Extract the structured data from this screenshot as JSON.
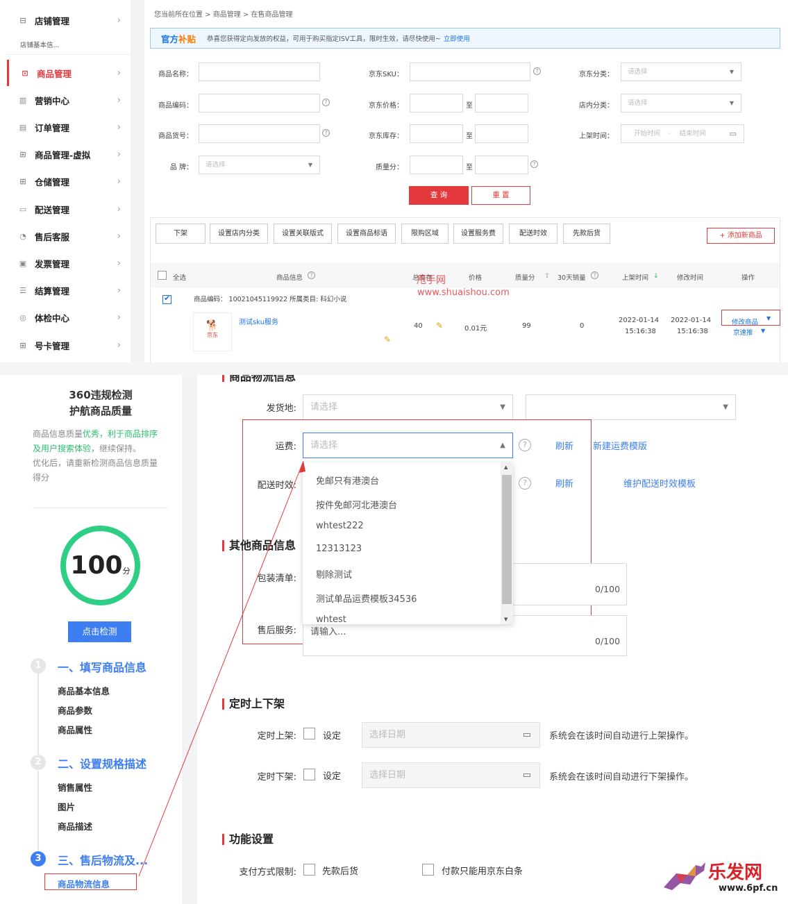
{
  "sidebar": {
    "store_mgmt": "店铺管理",
    "store_sub": "店铺基本信...",
    "items": [
      {
        "label": "商品管理",
        "icon": "bag-icon"
      },
      {
        "label": "营销中心",
        "icon": "chart-icon"
      },
      {
        "label": "订单管理",
        "icon": "doc-icon"
      },
      {
        "label": "商品管理-虚拟",
        "icon": "grid-icon"
      },
      {
        "label": "仓储管理",
        "icon": "grid-icon"
      },
      {
        "label": "配送管理",
        "icon": "truck-icon"
      },
      {
        "label": "售后客服",
        "icon": "headset-icon"
      },
      {
        "label": "发票管理",
        "icon": "invoice-icon"
      },
      {
        "label": "结算管理",
        "icon": "list-icon"
      },
      {
        "label": "体检中心",
        "icon": "shield-icon"
      },
      {
        "label": "号卡管理",
        "icon": "grid-icon"
      }
    ]
  },
  "breadcrumb": "您当前所在位置 > 商品管理 > 在售商品管理",
  "notice": {
    "tag_a": "官方",
    "tag_b": "补贴",
    "text": "恭喜您获得定向发放的权益，可用于购买指定ISV工具，限时生效，请尽快使用~",
    "link": "立即使用"
  },
  "filters": {
    "name": "商品名称：",
    "sku": "京东SKU：",
    "jd_cat": "京东分类：",
    "code": "商品编码：",
    "price": "京东价格：",
    "shop_cat": "店内分类：",
    "goods_no": "商品货号：",
    "stock": "京东库存：",
    "on_time": "上架时间：",
    "brand": "品 牌：",
    "quality": "质量分：",
    "placeholder_select": "请选择",
    "start": "开始时间",
    "sep": "-",
    "end": "结束时间",
    "to": "至"
  },
  "actions": {
    "query": "查 询",
    "reset": "重 置"
  },
  "toolbar": [
    "下架",
    "设置店内分类",
    "设置关联版式",
    "设置商品标语",
    "限购区域",
    "设置服务费",
    "配送时效",
    "先款后货"
  ],
  "add_product": "+ 添加新商品",
  "table": {
    "headers": {
      "select_all": "全选",
      "info": "商品信息",
      "stock": "总库存",
      "price": "价格",
      "quality": "质量分",
      "sales": "30天销量",
      "on_time": "上架时间",
      "mod_time": "修改时间",
      "op": "操作"
    },
    "row": {
      "meta": "商品编码：  10021045119922  所属类目: 科幻小说",
      "name": "测试sku服务",
      "img_label": "京东",
      "stock": "40",
      "price": "0.01元",
      "quality": "99",
      "sales": "0",
      "on_date": "2022-01-14",
      "on_clock": "15:16:38",
      "mod_date": "2022-01-14",
      "mod_clock": "15:16:38",
      "op1": "修改商品",
      "op2": "京速推"
    }
  },
  "watermark": {
    "text": "甩手网",
    "url": "www.shuaishou.com",
    "logo": "乐发网",
    "logo_url": "www.6pf.cn"
  },
  "quality_panel": {
    "title1": "360违规检测",
    "title2": "护航商品质量",
    "desc_a": "商品信息质量",
    "desc_b": "优秀，利于商品排序及用户搜索体验",
    "desc_c": "，继续保持。",
    "desc_d": "优化后，请重新检测商品信息质量得分",
    "score": "100",
    "unit": "分",
    "check_btn": "点击检测"
  },
  "steps": [
    {
      "num": "1",
      "title": "一、填写商品信息",
      "subs": [
        "商品基本信息",
        "商品参数",
        "商品属性"
      ]
    },
    {
      "num": "2",
      "title": "二、设置规格描述",
      "subs": [
        "销售属性",
        "图片",
        "商品描述"
      ]
    },
    {
      "num": "3",
      "title": "三、售后物流及...",
      "subs": [
        "商品物流信息"
      ]
    }
  ],
  "logistics": {
    "section_cut": "商品物流信息",
    "ship_from": "发货地:",
    "placeholder": "请选择",
    "freight": "运费:",
    "delivery": "配送时效:",
    "refresh": "刷新",
    "new_template": "新建运费模版",
    "maintain_template": "维护配送时效模板",
    "options": [
      "免邮只有港澳台",
      "按件免邮河北港澳台",
      "whtest222",
      "12313123",
      "剔除测试",
      "测试单品运费模板34536",
      "whtest"
    ]
  },
  "other": {
    "title": "其他商品信息",
    "packing": "包装清单:",
    "after_sale": "售后服务:",
    "placeholder": "请输入...",
    "count": "0/100"
  },
  "schedule": {
    "title": "定时上下架",
    "on": "定时上架:",
    "off": "定时下架:",
    "set": "设定",
    "date_ph": "选择日期",
    "on_note": "系统会在该时间自动进行上架操作。",
    "off_note": "系统会在该时间自动进行下架操作。"
  },
  "features": {
    "title": "功能设置",
    "pay_limit": "支付方式限制:",
    "prepay": "先款后货",
    "baitiao": "付款只能用京东白条"
  }
}
